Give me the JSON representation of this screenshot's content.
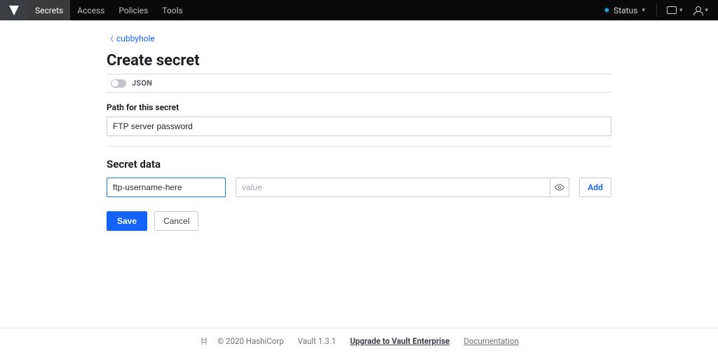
{
  "nav": {
    "tabs": [
      "Secrets",
      "Access",
      "Policies",
      "Tools"
    ],
    "active_index": 0,
    "status_label": "Status"
  },
  "breadcrumb": {
    "label": "cubbyhole"
  },
  "page": {
    "title": "Create secret",
    "json_toggle_label": "JSON",
    "path_label": "Path for this secret",
    "path_value": "FTP server password",
    "section_title": "Secret data"
  },
  "kv": {
    "key_value": "ftp-username-here",
    "value_placeholder": "value",
    "add_label": "Add"
  },
  "actions": {
    "save": "Save",
    "cancel": "Cancel"
  },
  "footer": {
    "copyright": "© 2020 HashiCorp",
    "version": "Vault 1.3.1",
    "upgrade": "Upgrade to Vault Enterprise",
    "docs": "Documentation"
  }
}
